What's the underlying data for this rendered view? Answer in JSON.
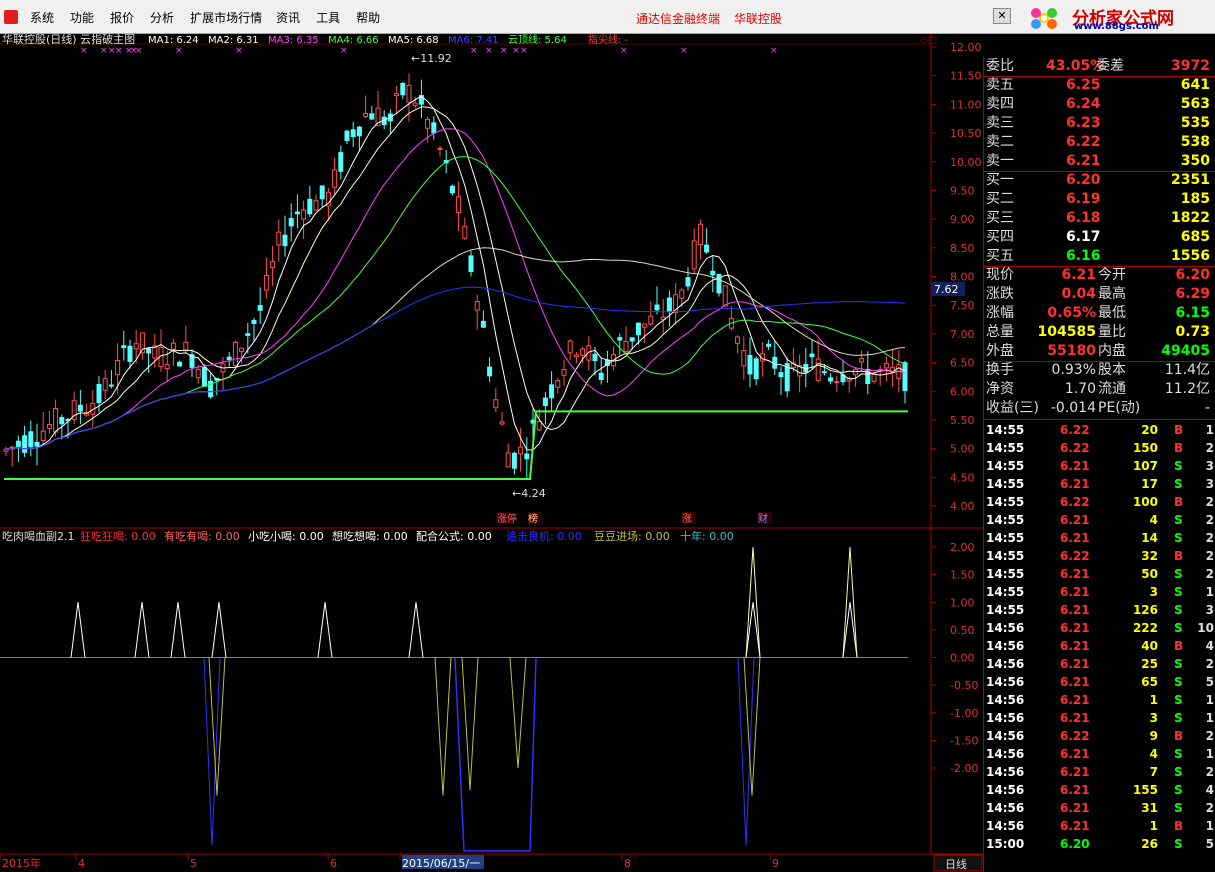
{
  "menus": [
    "系统",
    "功能",
    "报价",
    "分析",
    "扩展市场行情",
    "资讯",
    "工具",
    "帮助"
  ],
  "promo": [
    "通达信金融终端",
    "华联控股"
  ],
  "logo": {
    "title": "分析家公式网",
    "url": "www.88gs.com"
  },
  "main_header": {
    "title": "华联控股(日线) 云指破主图",
    "ma": [
      {
        "label": "MA1: 6.24",
        "color": "#ffffff"
      },
      {
        "label": "MA2: 6.31",
        "color": "#ffffff"
      },
      {
        "label": "MA3: 6.35",
        "color": "#ff40ff"
      },
      {
        "label": "MA4: 6.66",
        "color": "#40ff40"
      },
      {
        "label": "MA5: 6.68",
        "color": "#ffffff"
      },
      {
        "label": "MA6: 7.41",
        "color": "#4040ff"
      },
      {
        "label": "云顶线: 5.64",
        "color": "#40ff40"
      },
      {
        "label": "指尖线: -",
        "color": "#ff4040"
      }
    ]
  },
  "price_axis": [
    "12.00",
    "11.50",
    "11.00",
    "10.50",
    "10.00",
    "9.50",
    "9.00",
    "8.50",
    "8.00",
    "7.50",
    "7.00",
    "6.50",
    "6.00",
    "5.50",
    "5.00",
    "4.50",
    "4.00"
  ],
  "price_marker": "7.62",
  "annotations": {
    "high": "11.92",
    "low": "4.24"
  },
  "event_tags": [
    "涨停",
    "榜",
    "涨",
    "财"
  ],
  "sub_header": {
    "title": "吃肉喝血副2.1",
    "items": [
      {
        "label": "狂吃狂喝: 0.00",
        "color": "#ff3030"
      },
      {
        "label": "有吃有喝: 0.00",
        "color": "#ff6060"
      },
      {
        "label": "小吃小喝: 0.00",
        "color": "#ffffff"
      },
      {
        "label": "想吃想喝: 0.00",
        "color": "#ffffff"
      },
      {
        "label": "配合公式: 0.00",
        "color": "#ffffff"
      },
      {
        "label": "追击良机: 0.00",
        "color": "#3030ff"
      },
      {
        "label": "豆豆进场: 0.00",
        "color": "#c0c040"
      },
      {
        "label": "十年: 0.00",
        "color": "#40c0c0"
      }
    ]
  },
  "sub_axis": [
    "2.00",
    "1.50",
    "1.00",
    "0.50",
    "0.00",
    "-0.50",
    "-1.00",
    "-1.50",
    "-2.00"
  ],
  "date_axis": [
    "2015年",
    "4",
    "5",
    "6",
    "2015/06/15/一",
    "8",
    "9"
  ],
  "period_label": "日线",
  "order_book": {
    "weibi": {
      "label": "委比",
      "value": "43.05%",
      "label2": "委差",
      "value2": "3972"
    },
    "asks": [
      {
        "label": "卖五",
        "price": "6.25",
        "vol": "641"
      },
      {
        "label": "卖四",
        "price": "6.24",
        "vol": "563"
      },
      {
        "label": "卖三",
        "price": "6.23",
        "vol": "535"
      },
      {
        "label": "卖二",
        "price": "6.22",
        "vol": "538"
      },
      {
        "label": "卖一",
        "price": "6.21",
        "vol": "350"
      }
    ],
    "bids": [
      {
        "label": "买一",
        "price": "6.20",
        "vol": "2351",
        "color": "#ff3030"
      },
      {
        "label": "买二",
        "price": "6.19",
        "vol": "185",
        "color": "#ff3030"
      },
      {
        "label": "买三",
        "price": "6.18",
        "vol": "1822",
        "color": "#ff3030"
      },
      {
        "label": "买四",
        "price": "6.17",
        "vol": "685",
        "color": "#ffffff"
      },
      {
        "label": "买五",
        "price": "6.16",
        "vol": "1556",
        "color": "#00ff00"
      }
    ]
  },
  "quote": [
    {
      "l1": "现价",
      "v1": "6.21",
      "c1": "#ff3030",
      "l2": "今开",
      "v2": "6.20",
      "c2": "#ff3030"
    },
    {
      "l1": "涨跌",
      "v1": "0.04",
      "c1": "#ff3030",
      "l2": "最高",
      "v2": "6.29",
      "c2": "#ff3030"
    },
    {
      "l1": "涨幅",
      "v1": "0.65%",
      "c1": "#ff3030",
      "l2": "最低",
      "v2": "6.15",
      "c2": "#00ff00"
    },
    {
      "l1": "总量",
      "v1": "104585",
      "c1": "#ffff00",
      "l2": "量比",
      "v2": "0.73",
      "c2": "#ffff00"
    },
    {
      "l1": "外盘",
      "v1": "55180",
      "c1": "#ff3030",
      "l2": "内盘",
      "v2": "49405",
      "c2": "#00ff00"
    }
  ],
  "stats": [
    {
      "l1": "换手",
      "v1": "0.93%",
      "l2": "股本",
      "v2": "11.4亿"
    },
    {
      "l1": "净资",
      "v1": "1.70",
      "l2": "流通",
      "v2": "11.2亿"
    },
    {
      "l1": "收益(三)",
      "v1": "-0.014",
      "l2": "PE(动)",
      "v2": "-"
    }
  ],
  "ticks": [
    {
      "t": "14:55",
      "p": "6.22",
      "v": "20",
      "s": "B",
      "n": "1"
    },
    {
      "t": "14:55",
      "p": "6.22",
      "v": "150",
      "s": "B",
      "n": "2"
    },
    {
      "t": "14:55",
      "p": "6.21",
      "v": "107",
      "s": "S",
      "n": "3"
    },
    {
      "t": "14:55",
      "p": "6.21",
      "v": "17",
      "s": "S",
      "n": "3"
    },
    {
      "t": "14:55",
      "p": "6.22",
      "v": "100",
      "s": "B",
      "n": "2"
    },
    {
      "t": "14:55",
      "p": "6.21",
      "v": "4",
      "s": "S",
      "n": "2"
    },
    {
      "t": "14:55",
      "p": "6.21",
      "v": "14",
      "s": "S",
      "n": "2"
    },
    {
      "t": "14:55",
      "p": "6.22",
      "v": "32",
      "s": "B",
      "n": "2"
    },
    {
      "t": "14:55",
      "p": "6.21",
      "v": "50",
      "s": "S",
      "n": "2"
    },
    {
      "t": "14:55",
      "p": "6.21",
      "v": "3",
      "s": "S",
      "n": "1"
    },
    {
      "t": "14:55",
      "p": "6.21",
      "v": "126",
      "s": "S",
      "n": "3"
    },
    {
      "t": "14:56",
      "p": "6.21",
      "v": "222",
      "s": "S",
      "n": "10"
    },
    {
      "t": "14:56",
      "p": "6.21",
      "v": "40",
      "s": "B",
      "n": "4"
    },
    {
      "t": "14:56",
      "p": "6.21",
      "v": "25",
      "s": "S",
      "n": "2"
    },
    {
      "t": "14:56",
      "p": "6.21",
      "v": "65",
      "s": "S",
      "n": "5"
    },
    {
      "t": "14:56",
      "p": "6.21",
      "v": "1",
      "s": "S",
      "n": "1"
    },
    {
      "t": "14:56",
      "p": "6.21",
      "v": "3",
      "s": "S",
      "n": "1"
    },
    {
      "t": "14:56",
      "p": "6.22",
      "v": "9",
      "s": "B",
      "n": "2"
    },
    {
      "t": "14:56",
      "p": "6.21",
      "v": "4",
      "s": "S",
      "n": "1"
    },
    {
      "t": "14:56",
      "p": "6.21",
      "v": "7",
      "s": "S",
      "n": "2"
    },
    {
      "t": "14:56",
      "p": "6.21",
      "v": "155",
      "s": "S",
      "n": "4"
    },
    {
      "t": "14:56",
      "p": "6.21",
      "v": "31",
      "s": "S",
      "n": "2"
    },
    {
      "t": "14:56",
      "p": "6.21",
      "v": "1",
      "s": "B",
      "n": "1"
    },
    {
      "t": "15:00",
      "p": "6.20",
      "v": "26",
      "s": "S",
      "n": "5"
    }
  ]
}
